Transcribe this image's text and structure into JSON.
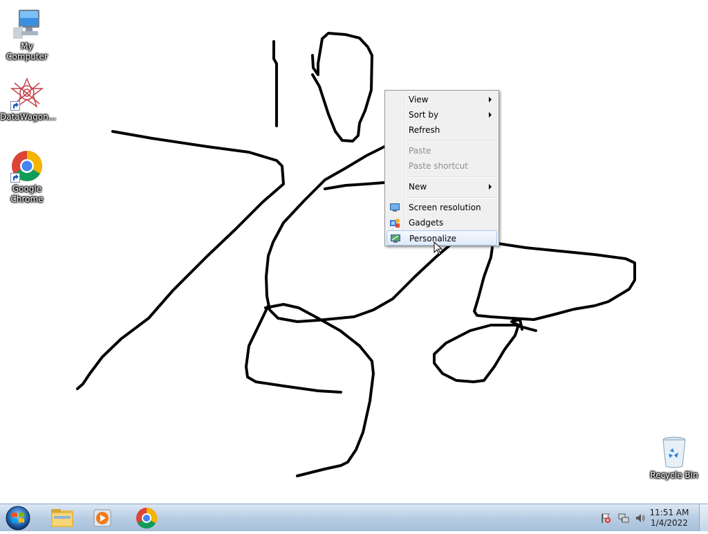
{
  "desktop": {
    "icons": [
      {
        "label": "My Computer"
      },
      {
        "label": "DataWagon..."
      },
      {
        "label": "Google Chrome"
      },
      {
        "label": "Recycle Bin"
      }
    ]
  },
  "context_menu": {
    "items": [
      {
        "label": "View",
        "submenu": true
      },
      {
        "label": "Sort by",
        "submenu": true
      },
      {
        "label": "Refresh"
      },
      {
        "label": "Paste",
        "disabled": true
      },
      {
        "label": "Paste shortcut",
        "disabled": true
      },
      {
        "label": "New",
        "submenu": true
      },
      {
        "label": "Screen resolution",
        "icon": "screen-resolution-icon"
      },
      {
        "label": "Gadgets",
        "icon": "gadgets-icon"
      },
      {
        "label": "Personalize",
        "icon": "personalize-icon",
        "highlighted": true
      }
    ]
  },
  "taskbar": {
    "start": "windows-start-orb-icon",
    "pinned": [
      "file-explorer-icon",
      "media-player-icon",
      "chrome-icon"
    ],
    "tray": [
      "action-center-flag-icon",
      "network-icon",
      "volume-icon"
    ],
    "clock": {
      "time": "11:51 AM",
      "date": "1/4/2022"
    }
  },
  "colors": {
    "desktop_background": "#ffffff",
    "menu_highlight": "#dfeaf9",
    "taskbar": "#b8cde3"
  }
}
